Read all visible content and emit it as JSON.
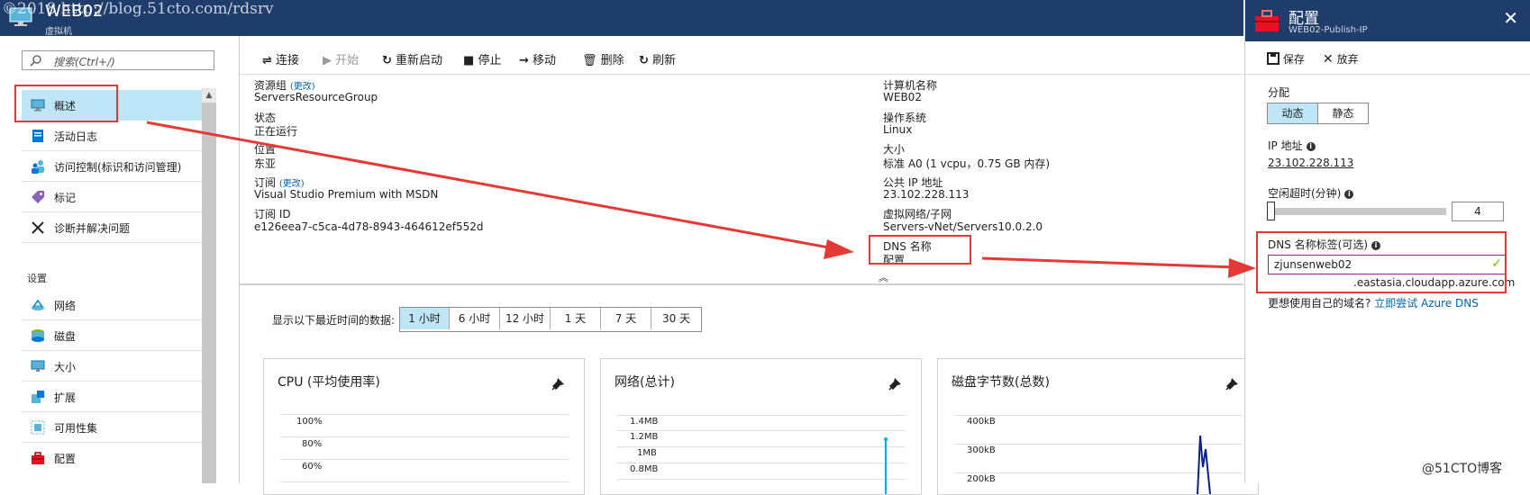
{
  "header": {
    "title": "WEB02",
    "subtitle": "虚拟机",
    "watermark": "©2018 http://blog.51cto.com/rdsrv"
  },
  "sidebar": {
    "search_placeholder": "搜索(Ctrl+/)",
    "items": [
      {
        "label": "概述",
        "icon": "monitor-icon"
      },
      {
        "label": "活动日志",
        "icon": "log-icon"
      },
      {
        "label": "访问控制(标识和访问管理)",
        "icon": "users-icon"
      },
      {
        "label": "标记",
        "icon": "tag-icon"
      },
      {
        "label": "诊断并解决问题",
        "icon": "wrench-icon"
      }
    ],
    "settings_header": "设置",
    "settings_items": [
      {
        "label": "网络",
        "icon": "network-icon"
      },
      {
        "label": "磁盘",
        "icon": "disk-icon"
      },
      {
        "label": "大小",
        "icon": "size-icon"
      },
      {
        "label": "扩展",
        "icon": "extension-icon"
      },
      {
        "label": "可用性集",
        "icon": "availability-icon"
      },
      {
        "label": "配置",
        "icon": "toolbox-icon"
      }
    ]
  },
  "toolbar": {
    "connect": "连接",
    "start": "开始",
    "restart": "重新启动",
    "stop": "停止",
    "move": "移动",
    "delete": "删除",
    "refresh": "刷新"
  },
  "essentials": {
    "left": [
      {
        "key": "资源组",
        "change": "(更改)",
        "value": "ServersResourceGroup",
        "link": true
      },
      {
        "key": "状态",
        "value": "正在运行",
        "link": false
      },
      {
        "key": "位置",
        "value": "东亚",
        "link": false
      },
      {
        "key": "订阅",
        "change": "(更改)",
        "value": "Visual Studio Premium with MSDN",
        "link": true
      },
      {
        "key": "订阅 ID",
        "value": "e126eea7-c5ca-4d78-8943-464612ef552d",
        "link": false
      }
    ],
    "right": [
      {
        "key": "计算机名称",
        "value": "WEB02",
        "link": false
      },
      {
        "key": "操作系统",
        "value": "Linux",
        "link": false
      },
      {
        "key": "大小",
        "value": "标准 A0 (1 vcpu，0.75 GB 内存)",
        "link": false
      },
      {
        "key": "公共 IP 地址",
        "value": "23.102.228.113",
        "link": true
      },
      {
        "key": "虚拟网络/子网",
        "value": "Servers-vNet/Servers10.0.2.0",
        "link": true
      },
      {
        "key": "DNS 名称",
        "value": "配置",
        "link": true
      }
    ],
    "collapse_icon": "chevron-double-up-icon"
  },
  "time_range": {
    "label": "显示以下最近时间的数据:",
    "options": [
      "1 小时",
      "6 小时",
      "12 小时",
      "1 天",
      "7 天",
      "30 天"
    ],
    "selected": 0
  },
  "charts": [
    {
      "title": "CPU (平均使用率)",
      "ticks": [
        "100%",
        "80%",
        "60%"
      ]
    },
    {
      "title": "网络(总计)",
      "ticks": [
        "1.4MB",
        "1.2MB",
        "1MB",
        "0.8MB"
      ]
    },
    {
      "title": "磁盘字节数(总数)",
      "ticks": [
        "400kB",
        "300kB",
        "200kB"
      ]
    }
  ],
  "blade": {
    "title": "配置",
    "subtitle": "WEB02-Publish-IP",
    "save": "保存",
    "discard": "放弃",
    "assignment_label": "分配",
    "assignment_options": [
      "动态",
      "静态"
    ],
    "assignment_selected": 0,
    "ip_label": "IP 地址",
    "ip_value": "23.102.228.113",
    "idle_label": "空闲超时(分钟)",
    "idle_value": "4",
    "idle_fraction": 0.0,
    "dns_label": "DNS 名称标签(可选)",
    "dns_value": "zjunsenweb02",
    "dns_suffix": ".eastasia.cloudapp.azure.com",
    "own_domain_text": "更想使用自己的域名?",
    "own_domain_link": "立即尝试 Azure DNS"
  },
  "colors": {
    "header": "#1e3d6b",
    "link": "#0063b1",
    "selected": "#bfe6f7",
    "highlight": "#e53935"
  },
  "footer_watermark": "@51CTO博客"
}
